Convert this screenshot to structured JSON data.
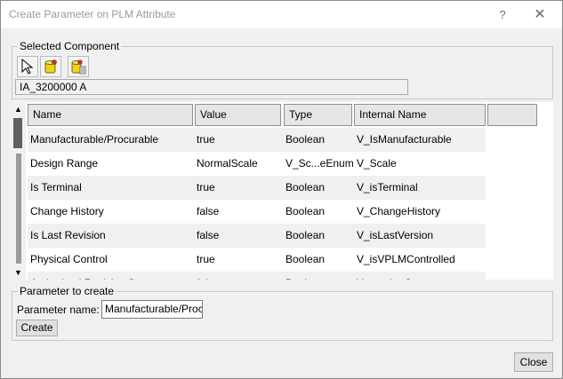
{
  "window": {
    "title": "Create Parameter on PLM Attribute",
    "help_label": "?",
    "close_glyph": "✕"
  },
  "selected_component": {
    "legend": "Selected Component",
    "tools": [
      {
        "icon": "select-arrow-icon"
      },
      {
        "icon": "database-icon"
      },
      {
        "icon": "database-list-icon"
      }
    ],
    "value": "IA_3200000 A"
  },
  "table": {
    "columns": [
      "Name",
      "Value",
      "Type",
      "Internal Name"
    ],
    "rows": [
      {
        "name": "Manufacturable/Procurable",
        "value": "true",
        "type": "Boolean",
        "internal": "V_IsManufacturable"
      },
      {
        "name": "Design Range",
        "value": "NormalScale",
        "type": "V_Sc...eEnum",
        "internal": "V_Scale"
      },
      {
        "name": "Is Terminal",
        "value": "true",
        "type": "Boolean",
        "internal": "V_isTerminal"
      },
      {
        "name": "Change History",
        "value": "false",
        "type": "Boolean",
        "internal": "V_ChangeHistory"
      },
      {
        "name": "Is Last Revision",
        "value": "false",
        "type": "Boolean",
        "internal": "V_isLastVersion"
      },
      {
        "name": "Physical Control",
        "value": "true",
        "type": "Boolean",
        "internal": "V_isVPLMControlled"
      },
      {
        "name": "Authorized Revision Sequence",
        "value": "false",
        "type": "Boolean",
        "internal": "V_versionComment"
      }
    ],
    "scroll_up_glyph": "▲",
    "scroll_down_glyph": "▼"
  },
  "parameter": {
    "legend": "Parameter to create",
    "name_label": "Parameter name:",
    "name_value": "Manufacturable/Procurable",
    "create_label": "Create"
  },
  "footer": {
    "close_label": "Close"
  },
  "colors": {
    "row_alt": "#f0f0f0",
    "row_normal": "#ffffff",
    "header_bg": "#e6e6e6"
  }
}
